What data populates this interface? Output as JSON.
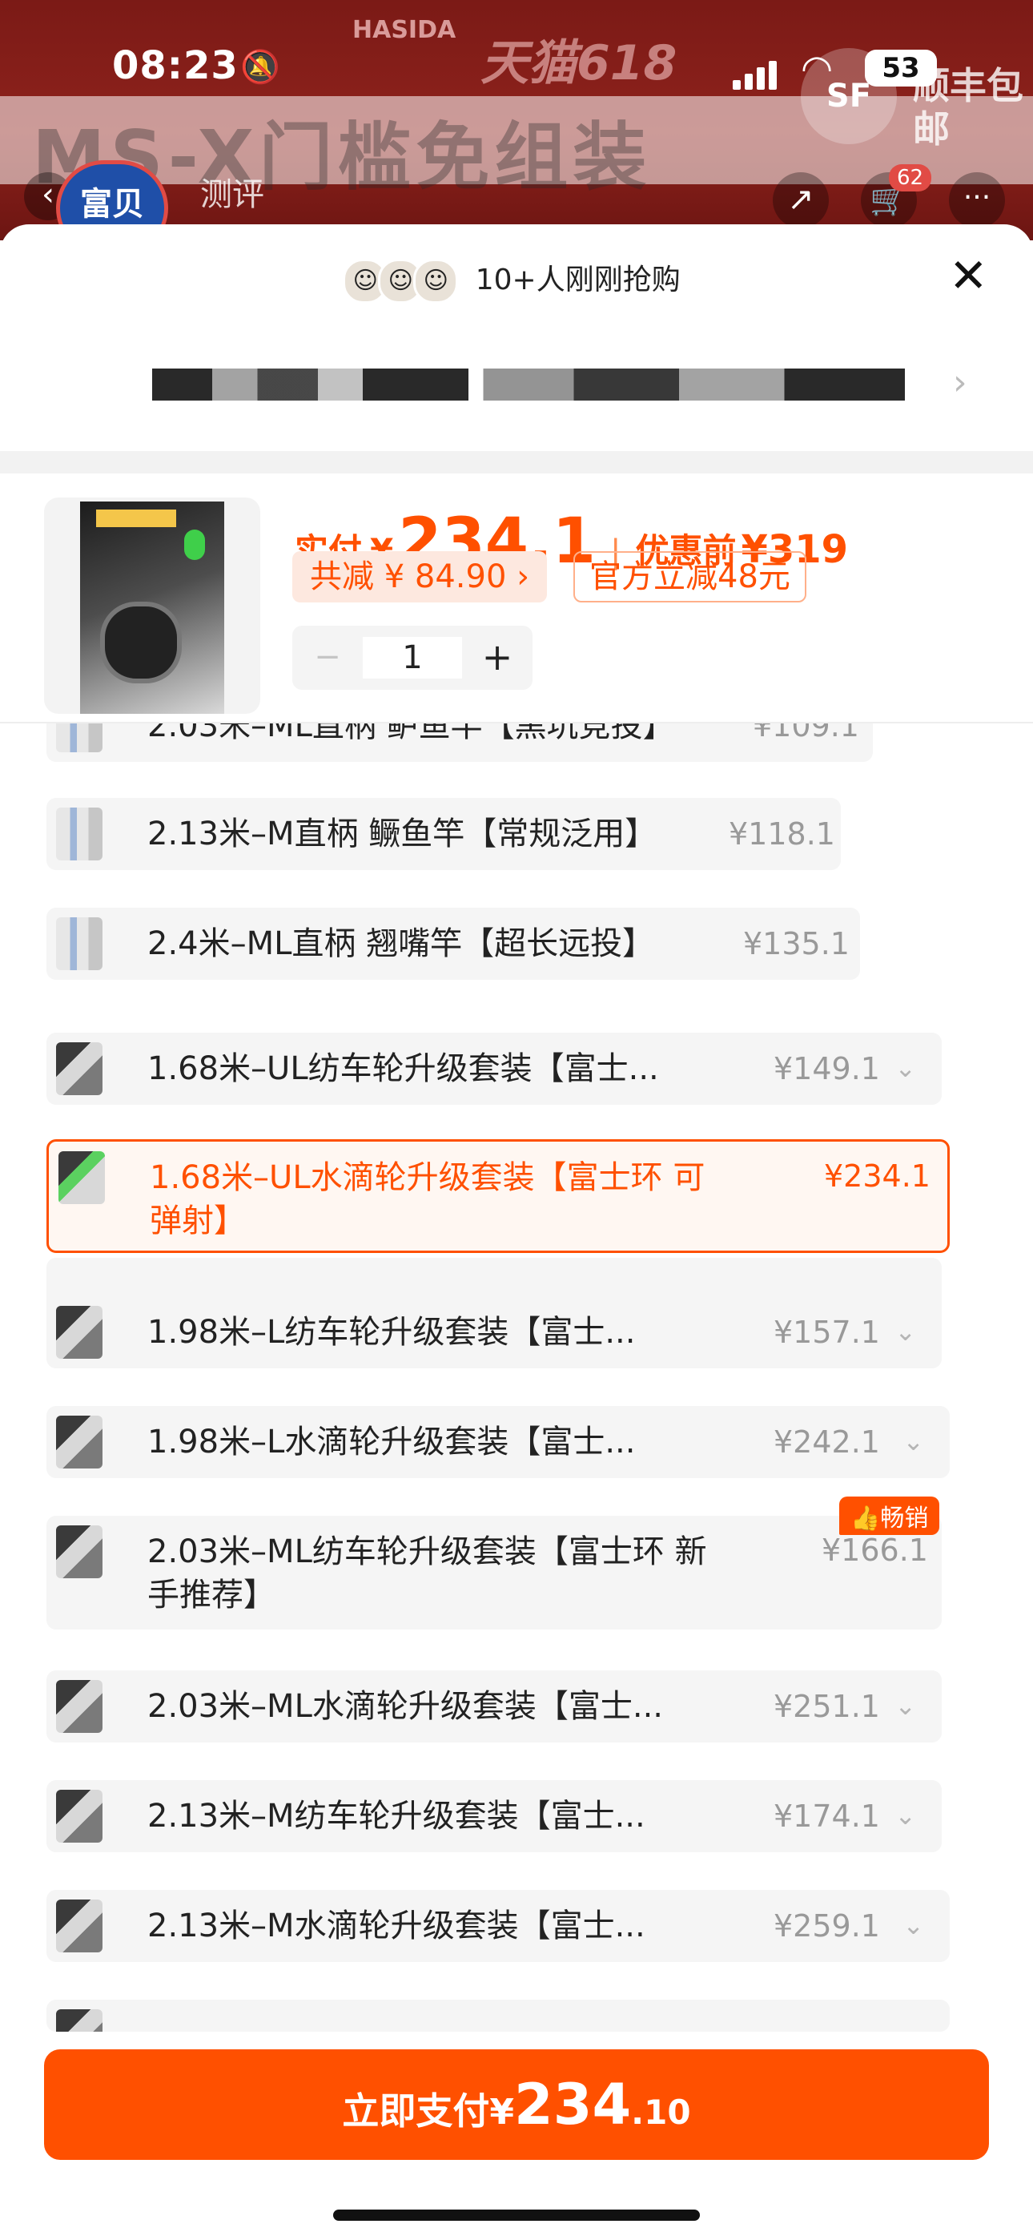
{
  "background": {
    "brand": "HASIDA",
    "campaign": "天猫618",
    "banner_text": "MS-X门槛免组装",
    "shipping_badge": "SF",
    "shipping_text": "顺丰包邮",
    "store_name": "富贝",
    "review_label": "测评",
    "cart_count": "62"
  },
  "status_bar": {
    "time": "08:23",
    "battery": "53"
  },
  "sheet": {
    "buyers_text": "10+人刚刚抢购",
    "close_icon": "close-icon",
    "summary": {
      "paid_label": "实付",
      "paid_currency": "¥",
      "paid_amount": "234.1",
      "separator": "|",
      "original_label": "优惠前",
      "original_amount": "¥319",
      "discount_total": "共减 ¥ 84.90 ›",
      "official_discount": "官方立减48元",
      "quantity": "1",
      "minus": "−",
      "plus": "+"
    },
    "sku_items": [
      {
        "label": "2.03米–ML直柄 鲈鱼竿【黑坑竞投】",
        "price": "¥109.1"
      },
      {
        "label": "2.13米–M直柄 鳜鱼竿【常规泛用】",
        "price": "¥118.1"
      },
      {
        "label": "2.4米–ML直柄  翘嘴竿【超长远投】",
        "price": "¥135.1"
      },
      {
        "label": "1.68米–UL纺车轮升级套装【富士...",
        "price": "¥149.1"
      },
      {
        "label": "1.68米–UL水滴轮升级套装【富士环 可弹射】",
        "price": "¥234.1"
      },
      {
        "label": "1.98米–L纺车轮升级套装【富士...",
        "price": "¥157.1"
      },
      {
        "label": "1.98米–L水滴轮升级套装【富士...",
        "price": "¥242.1"
      },
      {
        "label": "2.03米–ML纺车轮升级套装【富士环 新手推荐】",
        "price": "¥166.1",
        "badge": "畅销"
      },
      {
        "label": "2.03米–ML水滴轮升级套装【富士...",
        "price": "¥251.1"
      },
      {
        "label": "2.13米–M纺车轮升级套装【富士...",
        "price": "¥174.1"
      },
      {
        "label": "2.13米–M水滴轮升级套装【富士...",
        "price": "¥259.1"
      }
    ],
    "pay_button": {
      "label": "立即支付",
      "currency": "¥",
      "integer": "234",
      "decimal": ".10"
    }
  },
  "colors": {
    "accent": "#ff5000",
    "muted_price": "#999999",
    "sku_bg": "#f5f5f5"
  }
}
